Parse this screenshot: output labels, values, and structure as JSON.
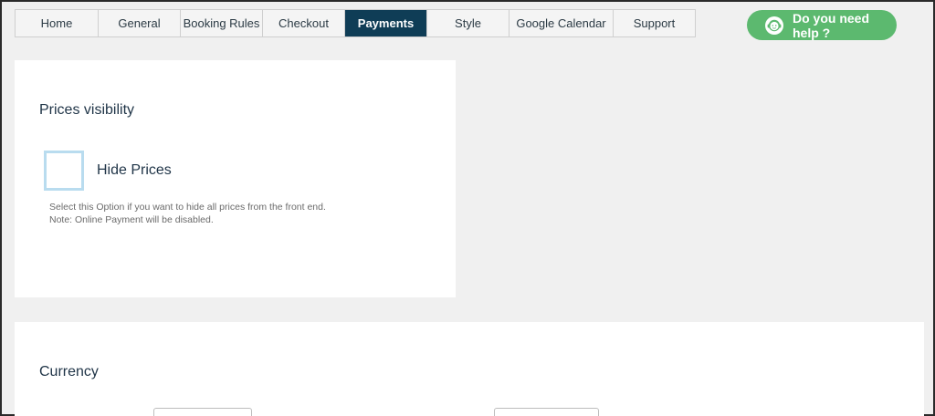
{
  "tabs": [
    {
      "label": "Home"
    },
    {
      "label": "General"
    },
    {
      "label": "Booking Rules"
    },
    {
      "label": "Checkout"
    },
    {
      "label": "Payments"
    },
    {
      "label": "Style"
    },
    {
      "label": "Google Calendar"
    },
    {
      "label": "Support"
    }
  ],
  "active_tab": "Payments",
  "help_button": {
    "label": "Do you need help ?",
    "icon": "support-agent-icon",
    "color": "#5cb96f"
  },
  "prices_visibility": {
    "title": "Prices visibility",
    "hide_prices": {
      "label": "Hide Prices",
      "checked": false,
      "help_line_1": "Select this Option if you want to hide all prices from the front end.",
      "help_line_2": "Note: Online Payment will be disabled."
    }
  },
  "currency": {
    "title": "Currency"
  },
  "colors": {
    "active_tab": "#0f3d56",
    "accent": "#5cb96f",
    "checkbox_border": "#b9dcef"
  }
}
